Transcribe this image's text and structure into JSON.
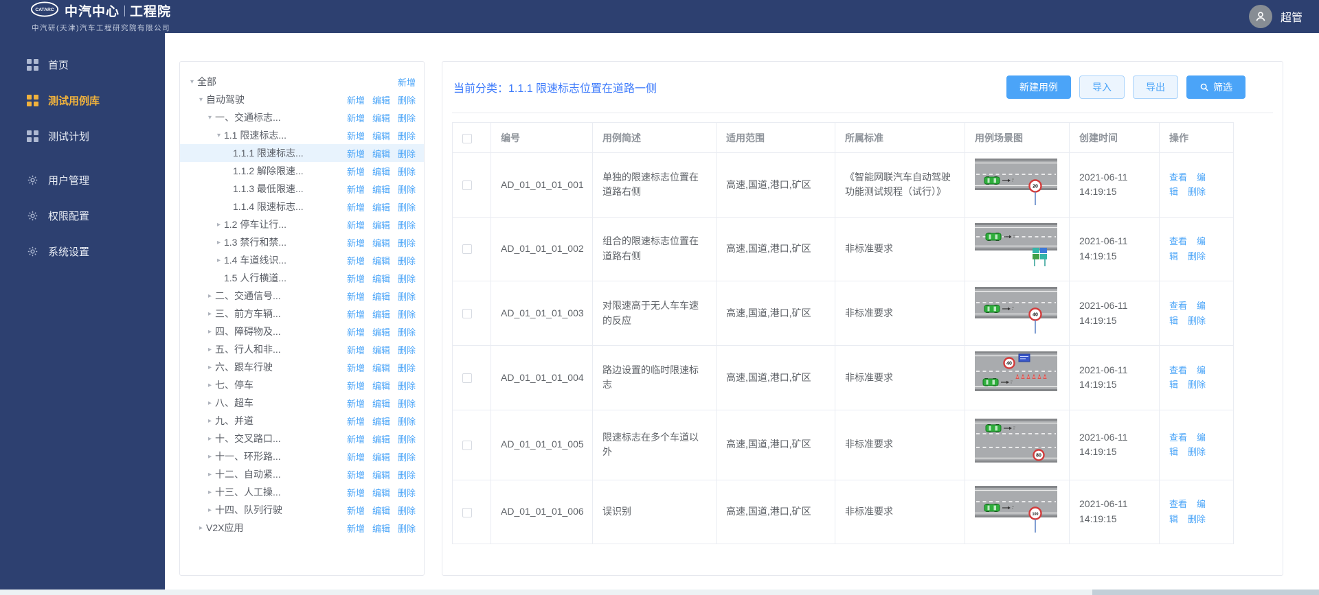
{
  "header": {
    "logo_badge": "CATARC",
    "logo_title_left": "中汽中心",
    "logo_title_right": "工程院",
    "logo_subtitle": "中汽研(天津)汽车工程研究院有限公司",
    "user_name": "超管"
  },
  "sidebar": {
    "items": [
      {
        "key": "home",
        "label": "首页",
        "icon": "grid",
        "active": false,
        "group_gap": false
      },
      {
        "key": "test-case-library",
        "label": "测试用例库",
        "icon": "grid",
        "active": true,
        "group_gap": false
      },
      {
        "key": "test-plan",
        "label": "测试计划",
        "icon": "grid",
        "active": false,
        "group_gap": false
      },
      {
        "key": "user-management",
        "label": "用户管理",
        "icon": "gear",
        "active": false,
        "group_gap": true
      },
      {
        "key": "permission-config",
        "label": "权限配置",
        "icon": "gear",
        "active": false,
        "group_gap": false
      },
      {
        "key": "system-settings",
        "label": "系统设置",
        "icon": "gear",
        "active": false,
        "group_gap": false
      }
    ]
  },
  "tree": {
    "actions": {
      "add": "新增",
      "edit": "编辑",
      "delete": "删除"
    },
    "nodes": [
      {
        "label": "全部",
        "level": 0,
        "state": "expanded",
        "selected": false,
        "links": [
          "add"
        ]
      },
      {
        "label": "自动驾驶",
        "level": 1,
        "state": "expanded",
        "selected": false,
        "links": [
          "add",
          "edit",
          "delete"
        ]
      },
      {
        "label": "一、交通标志...",
        "level": 2,
        "state": "expanded",
        "selected": false,
        "links": [
          "add",
          "edit",
          "delete"
        ]
      },
      {
        "label": "1.1 限速标志...",
        "level": 3,
        "state": "expanded",
        "selected": false,
        "links": [
          "add",
          "edit",
          "delete"
        ]
      },
      {
        "label": "1.1.1 限速标志...",
        "level": 4,
        "state": "leaf",
        "selected": true,
        "links": [
          "add",
          "edit",
          "delete"
        ]
      },
      {
        "label": "1.1.2 解除限速...",
        "level": 4,
        "state": "leaf",
        "selected": false,
        "links": [
          "add",
          "edit",
          "delete"
        ]
      },
      {
        "label": "1.1.3 最低限速...",
        "level": 4,
        "state": "leaf",
        "selected": false,
        "links": [
          "add",
          "edit",
          "delete"
        ]
      },
      {
        "label": "1.1.4 限速标志...",
        "level": 4,
        "state": "leaf",
        "selected": false,
        "links": [
          "add",
          "edit",
          "delete"
        ]
      },
      {
        "label": "1.2 停车让行...",
        "level": 3,
        "state": "collapsed",
        "selected": false,
        "links": [
          "add",
          "edit",
          "delete"
        ]
      },
      {
        "label": "1.3 禁行和禁...",
        "level": 3,
        "state": "collapsed",
        "selected": false,
        "links": [
          "add",
          "edit",
          "delete"
        ]
      },
      {
        "label": "1.4 车道线识...",
        "level": 3,
        "state": "collapsed",
        "selected": false,
        "links": [
          "add",
          "edit",
          "delete"
        ]
      },
      {
        "label": "1.5 人行横道...",
        "level": 3,
        "state": "leaf",
        "selected": false,
        "links": [
          "add",
          "edit",
          "delete"
        ]
      },
      {
        "label": "二、交通信号...",
        "level": 2,
        "state": "collapsed",
        "selected": false,
        "links": [
          "add",
          "edit",
          "delete"
        ]
      },
      {
        "label": "三、前方车辆...",
        "level": 2,
        "state": "collapsed",
        "selected": false,
        "links": [
          "add",
          "edit",
          "delete"
        ]
      },
      {
        "label": "四、障碍物及...",
        "level": 2,
        "state": "collapsed",
        "selected": false,
        "links": [
          "add",
          "edit",
          "delete"
        ]
      },
      {
        "label": "五、行人和非...",
        "level": 2,
        "state": "collapsed",
        "selected": false,
        "links": [
          "add",
          "edit",
          "delete"
        ]
      },
      {
        "label": "六、跟车行驶",
        "level": 2,
        "state": "collapsed",
        "selected": false,
        "links": [
          "add",
          "edit",
          "delete"
        ]
      },
      {
        "label": "七、停车",
        "level": 2,
        "state": "collapsed",
        "selected": false,
        "links": [
          "add",
          "edit",
          "delete"
        ]
      },
      {
        "label": "八、超车",
        "level": 2,
        "state": "collapsed",
        "selected": false,
        "links": [
          "add",
          "edit",
          "delete"
        ]
      },
      {
        "label": "九、并道",
        "level": 2,
        "state": "collapsed",
        "selected": false,
        "links": [
          "add",
          "edit",
          "delete"
        ]
      },
      {
        "label": "十、交叉路口...",
        "level": 2,
        "state": "collapsed",
        "selected": false,
        "links": [
          "add",
          "edit",
          "delete"
        ]
      },
      {
        "label": "十一、环形路...",
        "level": 2,
        "state": "collapsed",
        "selected": false,
        "links": [
          "add",
          "edit",
          "delete"
        ]
      },
      {
        "label": "十二、自动紧...",
        "level": 2,
        "state": "collapsed",
        "selected": false,
        "links": [
          "add",
          "edit",
          "delete"
        ]
      },
      {
        "label": "十三、人工操...",
        "level": 2,
        "state": "collapsed",
        "selected": false,
        "links": [
          "add",
          "edit",
          "delete"
        ]
      },
      {
        "label": "十四、队列行驶",
        "level": 2,
        "state": "collapsed",
        "selected": false,
        "links": [
          "add",
          "edit",
          "delete"
        ]
      },
      {
        "label": "V2X应用",
        "level": 1,
        "state": "collapsed",
        "selected": false,
        "links": [
          "add",
          "edit",
          "delete"
        ]
      }
    ]
  },
  "main": {
    "category_label": "当前分类：",
    "category_value": "1.1.1 限速标志位置在道路一侧",
    "buttons": {
      "create": "新建用例",
      "import": "导入",
      "export": "导出",
      "filter": "筛选"
    },
    "table": {
      "columns": [
        "编号",
        "用例简述",
        "适用范围",
        "所属标准",
        "用例场景图",
        "创建时间",
        "操作"
      ],
      "row_actions": [
        "查看",
        "编辑",
        "删除"
      ],
      "rows": [
        {
          "id": "AD_01_01_01_001",
          "desc": "单独的限速标志位置在道路右侧",
          "scope": "高速,国道,港口,矿区",
          "standard": "《智能网联汽车自动驾驶功能测试规程（试行）》",
          "scene": {
            "variant": "sign-right",
            "sign_text": "20"
          },
          "created": "2021-06-11 14:19:15"
        },
        {
          "id": "AD_01_01_01_002",
          "desc": "组合的限速标志位置在道路右侧",
          "scope": "高速,国道,港口,矿区",
          "standard": "非标准要求",
          "scene": {
            "variant": "combo-boards",
            "sign_text": ""
          },
          "created": "2021-06-11 14:19:15"
        },
        {
          "id": "AD_01_01_01_003",
          "desc": "对限速高于无人车车速的反应",
          "scope": "高速,国道,港口,矿区",
          "standard": "非标准要求",
          "scene": {
            "variant": "sign-right",
            "sign_text": "40"
          },
          "created": "2021-06-11 14:19:15"
        },
        {
          "id": "AD_01_01_01_004",
          "desc": "路边设置的临时限速标志",
          "scope": "高速,国道,港口,矿区",
          "standard": "非标准要求",
          "scene": {
            "variant": "temp-works",
            "sign_text": "40"
          },
          "created": "2021-06-11 14:19:15"
        },
        {
          "id": "AD_01_01_01_005",
          "desc": "限速标志在多个车道以外",
          "scope": "高速,国道,港口,矿区",
          "standard": "非标准要求",
          "scene": {
            "variant": "multi-lane",
            "sign_text": "80"
          },
          "created": "2021-06-11 14:19:15"
        },
        {
          "id": "AD_01_01_01_006",
          "desc": "误识别",
          "scope": "高速,国道,港口,矿区",
          "standard": "非标准要求",
          "scene": {
            "variant": "sign-right",
            "sign_text": "100"
          },
          "created": "2021-06-11 14:19:15"
        }
      ]
    }
  },
  "colors": {
    "navy": "#2d4070",
    "accent_blue": "#4ba4f8",
    "title_blue": "#3e7bfb",
    "active_yellow": "#f0b23c",
    "link_blue": "#4da6f8",
    "selected_row_bg": "#e8f3fd"
  }
}
